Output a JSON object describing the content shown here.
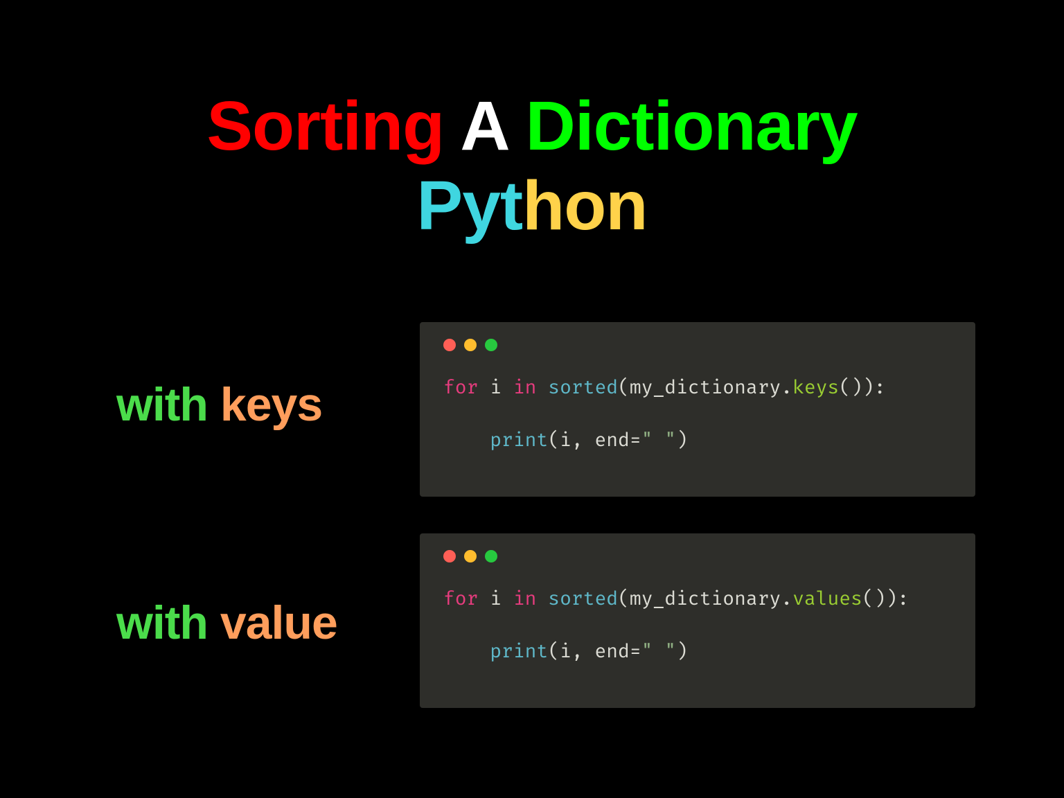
{
  "title": {
    "sorting": "Sorting",
    "a": "A",
    "dictionary": "Dictionary",
    "pyt": "Pyt",
    "hon": "hon"
  },
  "rows": [
    {
      "label_with": "with",
      "label_word": "keys",
      "code": {
        "kw_for": "for",
        "var": "i",
        "kw_in": "in",
        "fn": "sorted",
        "obj": "my_dictionary",
        "method": "keys",
        "print": "print",
        "print_args": "i, end=",
        "str": "\" \""
      }
    },
    {
      "label_with": "with",
      "label_word": "value",
      "code": {
        "kw_for": "for",
        "var": "i",
        "kw_in": "in",
        "fn": "sorted",
        "obj": "my_dictionary",
        "method": "values",
        "print": "print",
        "print_args": "i, end=",
        "str": "\" \""
      }
    }
  ]
}
